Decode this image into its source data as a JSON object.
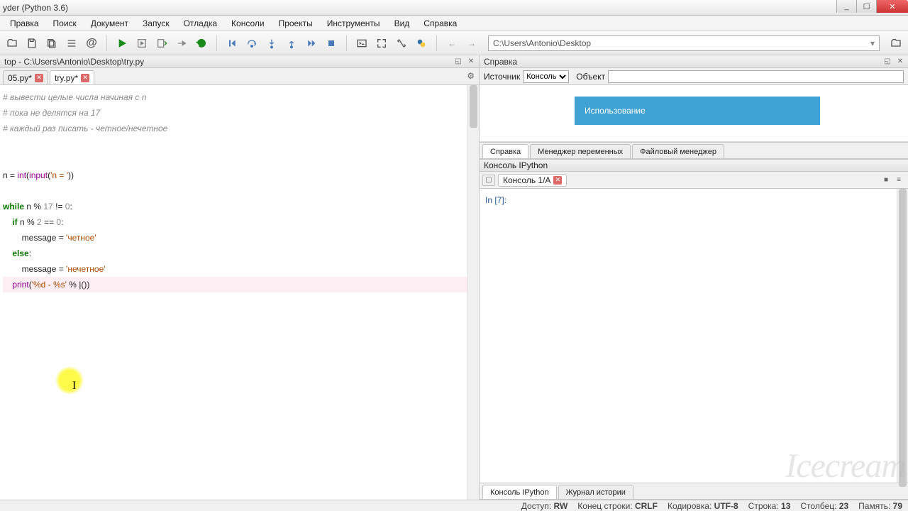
{
  "title": "yder (Python 3.6)",
  "menu": [
    "Правка",
    "Поиск",
    "Документ",
    "Запуск",
    "Отладка",
    "Консоли",
    "Проекты",
    "Инструменты",
    "Вид",
    "Справка"
  ],
  "path": "C:\\Users\\Antonio\\Desktop",
  "editor": {
    "panetitle": "top - C:\\Users\\Antonio\\Desktop\\try.py",
    "tabs": [
      {
        "label": "05.py*",
        "active": false
      },
      {
        "label": "try.py*",
        "active": true
      }
    ],
    "code": [
      {
        "cls": "cm-comment",
        "t": "# вывести целые числа начиная с n"
      },
      {
        "cls": "cm-comment",
        "t": "# пока не делятся на 17"
      },
      {
        "cls": "cm-comment",
        "t": "# каждый раз писать - четное/нечетное"
      },
      {
        "cls": "",
        "t": ""
      },
      {
        "cls": "",
        "t": ""
      },
      {
        "html": "n = <span class='cm-builtin'>int</span>(<span class='cm-builtin'>input</span>(<span class='cm-str'>'n = '</span>))"
      },
      {
        "cls": "",
        "t": ""
      },
      {
        "html": "<span class='cm-kw'>while</span> n % <span class='cm-num'>17</span> != <span class='cm-num'>0</span>:"
      },
      {
        "html": "    <span class='cm-kw'>if</span> n % <span class='cm-num'>2</span> == <span class='cm-num'>0</span>:"
      },
      {
        "html": "        message = <span class='cm-str'>'четное'</span>"
      },
      {
        "html": "    <span class='cm-kw'>else</span>:"
      },
      {
        "html": "        message = <span class='cm-str'>'нечетное'</span>"
      },
      {
        "hl": true,
        "html": "    <span class='cm-builtin'>print</span>(<span class='cm-str'>'%d - %s'</span> % |())"
      }
    ]
  },
  "help": {
    "panetitle": "Справка",
    "source_label": "Источник",
    "source_value": "Консоль",
    "object_label": "Объект",
    "usage": "Использование",
    "tabs": [
      "Справка",
      "Менеджер переменных",
      "Файловый менеджер"
    ]
  },
  "ipython": {
    "panetitle": "Консоль IPython",
    "tab": "Консоль 1/A",
    "prompt": "In [7]:",
    "bottom_tabs": [
      "Консоль IPython",
      "Журнал истории"
    ]
  },
  "status": {
    "access_l": "Доступ:",
    "access_v": "RW",
    "eol_l": "Конец строки:",
    "eol_v": "CRLF",
    "enc_l": "Кодировка:",
    "enc_v": "UTF-8",
    "line_l": "Строка:",
    "line_v": "13",
    "col_l": "Столбец:",
    "col_v": "23",
    "mem_l": "Память:",
    "mem_v": "79"
  },
  "watermark": "Icecream"
}
